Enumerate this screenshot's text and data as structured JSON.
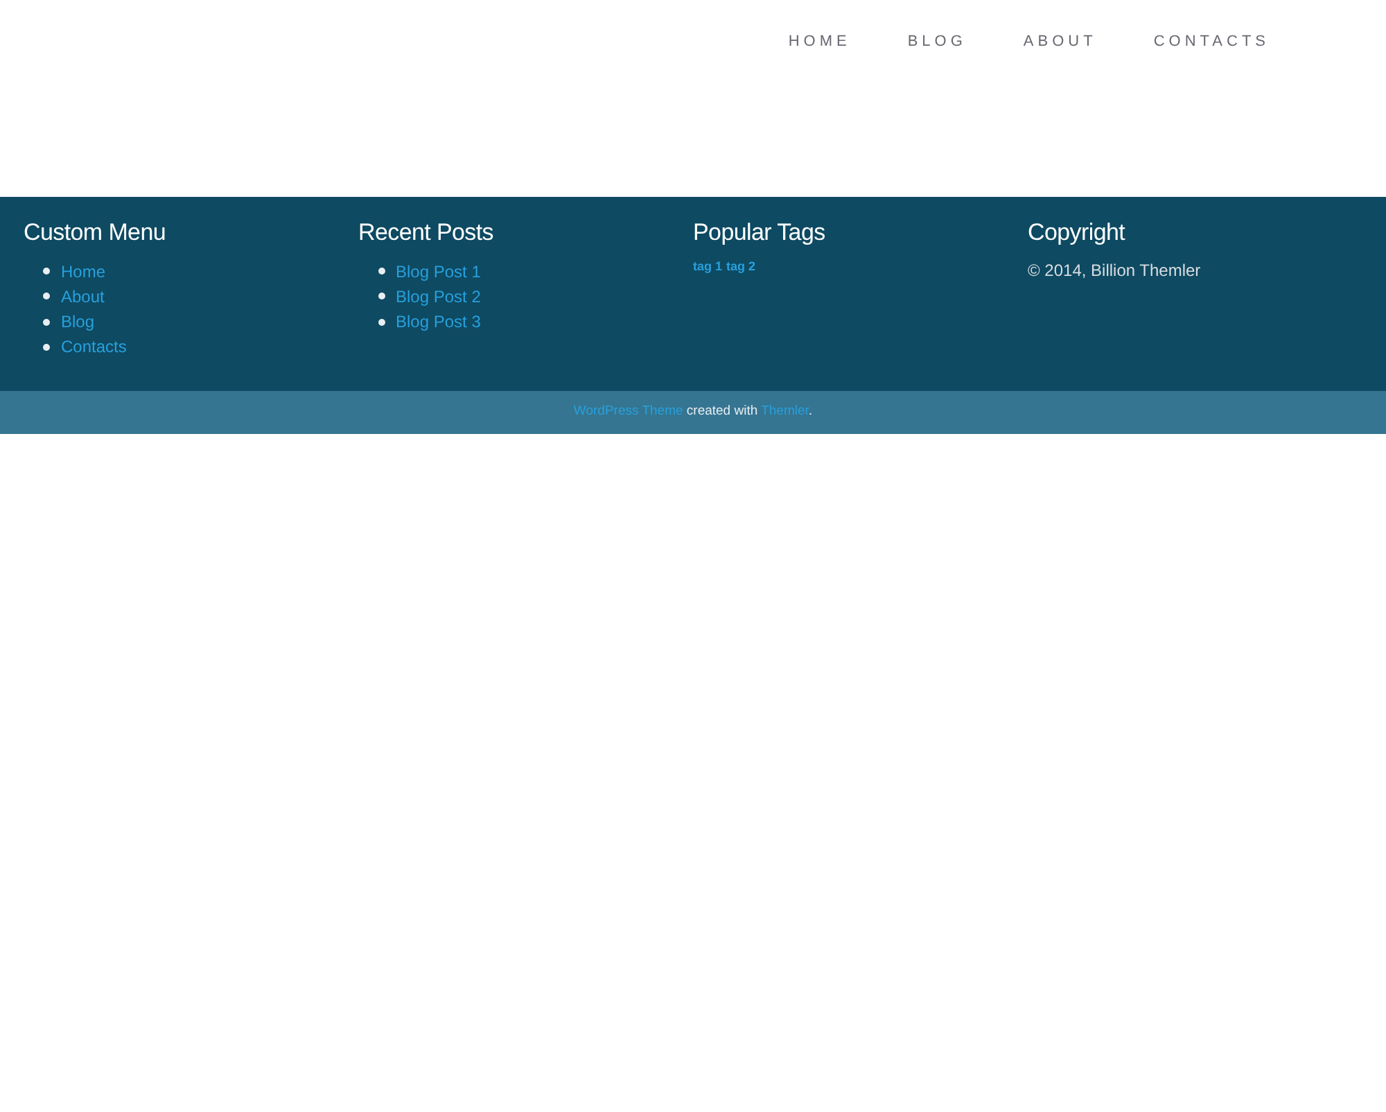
{
  "nav": [
    {
      "label": "HOME"
    },
    {
      "label": "BLOG"
    },
    {
      "label": "ABOUT"
    },
    {
      "label": "CONTACTS"
    }
  ],
  "footer": {
    "widgets": [
      {
        "kind": "links",
        "title": "Custom Menu",
        "items": [
          "Home",
          "About",
          "Blog",
          "Contacts"
        ]
      },
      {
        "kind": "links",
        "title": "Recent Posts",
        "items": [
          "Blog Post 1",
          "Blog Post 2",
          "Blog Post 3"
        ]
      },
      {
        "kind": "tags",
        "title": "Popular Tags",
        "items": [
          "tag 1",
          "tag 2"
        ]
      },
      {
        "kind": "text",
        "title": "Copyright",
        "text": "© 2014, Billion Themler"
      }
    ]
  },
  "credits": [
    {
      "kind": "link",
      "text": "WordPress Theme"
    },
    {
      "kind": "text",
      "text": " created with "
    },
    {
      "kind": "link",
      "text": "Themler"
    },
    {
      "kind": "text",
      "text": "."
    }
  ]
}
